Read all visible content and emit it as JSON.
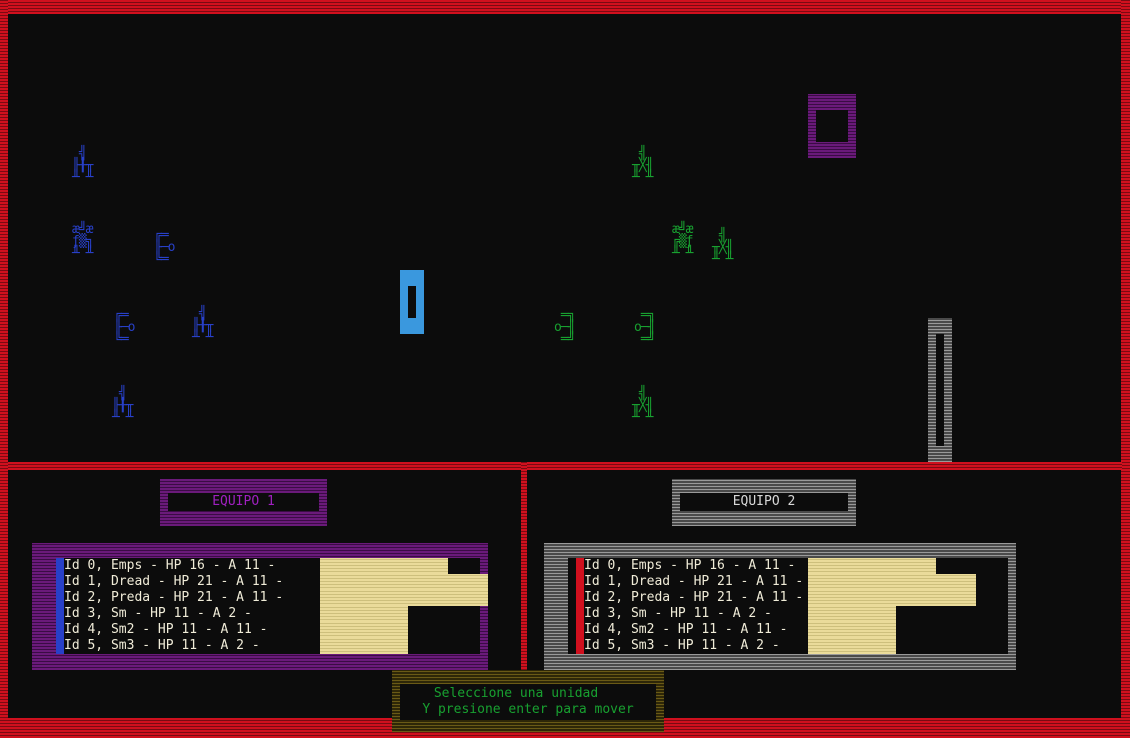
{
  "team1": {
    "title": "EQUIPO 1",
    "units": [
      {
        "text": "Id 0, Emps - HP 16 - A 11 -",
        "hp": 16
      },
      {
        "text": "Id 1, Dread - HP 21 - A 11 -",
        "hp": 21
      },
      {
        "text": "Id 2, Preda - HP 21 - A 11 -",
        "hp": 21
      },
      {
        "text": "Id 3, Sm - HP 11 - A 2 -",
        "hp": 11
      },
      {
        "text": "Id 4, Sm2 - HP 11 - A 11 -",
        "hp": 11
      },
      {
        "text": "Id 5, Sm3 - HP 11 - A 2 -",
        "hp": 11
      }
    ]
  },
  "team2": {
    "title": "EQUIPO 2",
    "units": [
      {
        "text": "Id 0, Emps - HP 16 - A 11 -",
        "hp": 16
      },
      {
        "text": "Id 1, Dread - HP 21 - A 11 -",
        "hp": 21
      },
      {
        "text": "Id 2, Preda - HP 21 - A 11 -",
        "hp": 21
      },
      {
        "text": "Id 3, Sm - HP 11 - A 2 -",
        "hp": 11
      },
      {
        "text": "Id 4, Sm2 - HP 11 - A 11 -",
        "hp": 11
      },
      {
        "text": "Id 5, Sm3 - HP 11 - A 2 -",
        "hp": 11
      }
    ]
  },
  "message": {
    "line1": "Seleccione una unidad",
    "line2": "Y presione enter para mover"
  },
  "colors": {
    "border": "#d0101e",
    "team1": "#2840c8",
    "team2": "#18a030",
    "selected": "#3a98de"
  }
}
